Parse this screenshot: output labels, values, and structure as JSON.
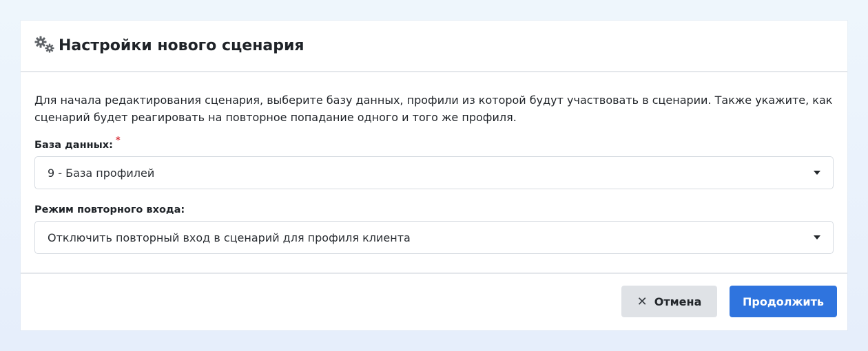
{
  "dialog": {
    "title": "Настройки нового сценария",
    "icon": "gears-icon",
    "description": "Для начала редактирования сценария, выберите базу данных, профили из которой будут участвовать в сценарии. Также укажите, как сценарий будет реагировать на повторное попадание одного и того же профиля."
  },
  "database_field": {
    "label": "База данных:",
    "required_mark": "*",
    "value": "9 - База профилей"
  },
  "reentry_field": {
    "label": "Режим повторного входа:",
    "value": "Отключить повторный вход в сценарий для профиля клиента"
  },
  "footer": {
    "cancel_icon": "✕",
    "cancel_label": "Отмена",
    "continue_label": "Продолжить"
  },
  "colors": {
    "primary": "#2f74de",
    "secondary_button": "#dfe2e6",
    "required": "#d9363e",
    "background": "#eaf2fb"
  }
}
